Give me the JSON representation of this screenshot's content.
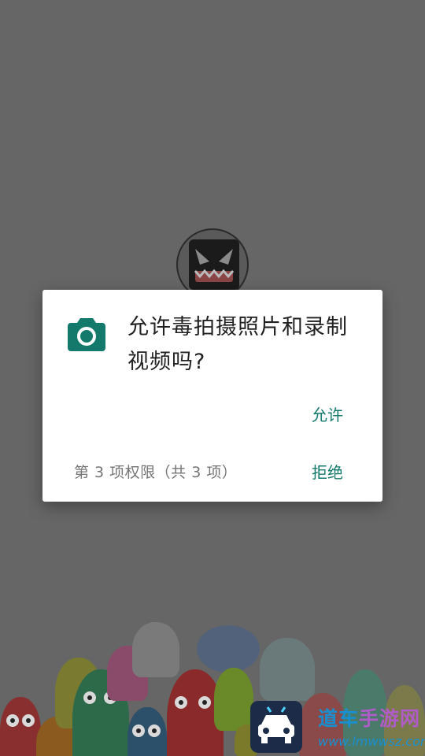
{
  "dialog": {
    "title": "允许毒拍摄照片和录制视频吗?",
    "allow_label": "允许",
    "deny_label": "拒绝",
    "counter": "第 3 项权限（共 3 项）"
  },
  "watermark": {
    "site_name_part1": "道车",
    "site_name_part2": "手游网",
    "url": "www.lmwwsz.com"
  },
  "colors": {
    "accent": "#137a6b",
    "scrim": "#666666",
    "dialog_bg": "#ffffff",
    "title_text": "#212121",
    "secondary_text": "#757575"
  },
  "icons": {
    "permission": "camera-icon"
  }
}
